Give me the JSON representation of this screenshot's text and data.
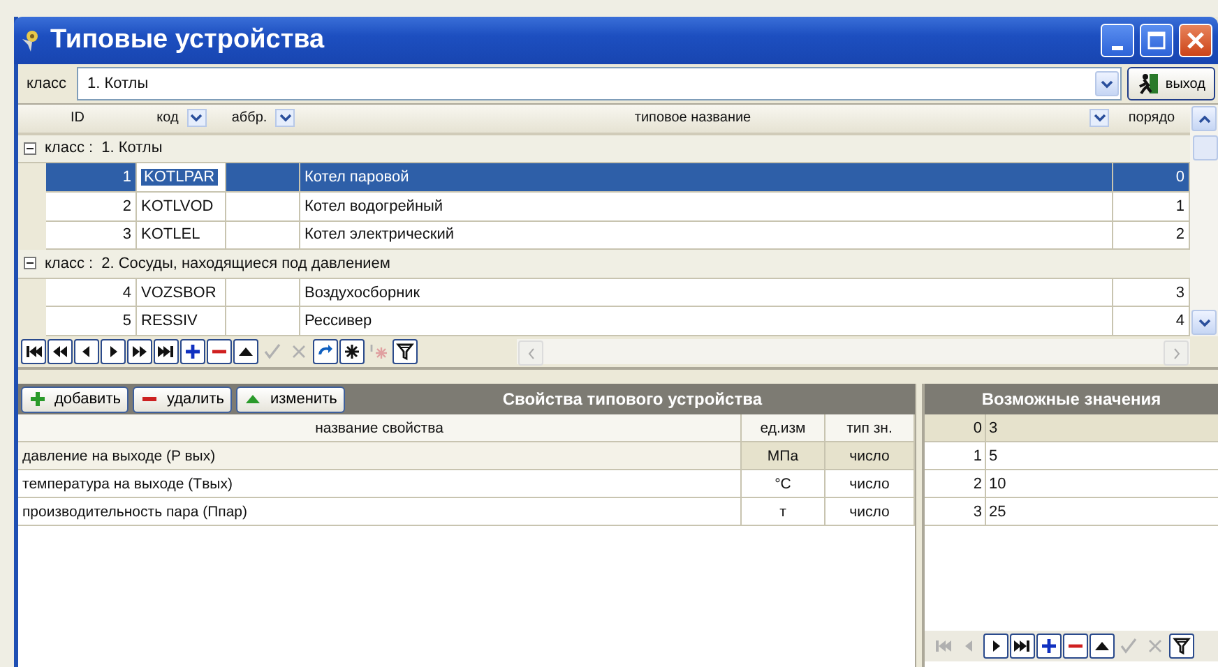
{
  "window": {
    "title": "Типовые устройства"
  },
  "class_filter": {
    "label": "класс",
    "value": "1. Котлы"
  },
  "exit_button": {
    "label": "выход"
  },
  "grid": {
    "columns": [
      {
        "label": "ID",
        "dropdown": false
      },
      {
        "label": "код",
        "dropdown": true
      },
      {
        "label": "аббр.",
        "dropdown": true
      },
      {
        "label": "типовое название",
        "dropdown": true
      },
      {
        "label": "порядо",
        "dropdown": false
      }
    ],
    "groups": [
      {
        "label": "класс :",
        "name": "1. Котлы",
        "expanded": true,
        "rows": [
          {
            "id": "1",
            "code": "KOTLPAR",
            "name": "Котел паровой",
            "order": "0",
            "selected": true
          },
          {
            "id": "2",
            "code": "KOTLVOD",
            "name": "Котел водогрейный",
            "order": "1",
            "selected": false
          },
          {
            "id": "3",
            "code": "KOTLEL",
            "name": "Котел электрический",
            "order": "2",
            "selected": false
          }
        ]
      },
      {
        "label": "класс :",
        "name": "2. Сосуды, находящиеся под давлением",
        "expanded": true,
        "rows": [
          {
            "id": "4",
            "code": "VOZSBOR",
            "name": "Воздухосборник",
            "order": "3",
            "selected": false
          },
          {
            "id": "5",
            "code": "RESSIV",
            "name": "Рессивер",
            "order": "4",
            "selected": false
          }
        ]
      }
    ]
  },
  "grid_nav": [
    {
      "kind": "first",
      "disabled": false
    },
    {
      "kind": "prior-page",
      "disabled": false
    },
    {
      "kind": "prior",
      "disabled": false
    },
    {
      "kind": "next",
      "disabled": false
    },
    {
      "kind": "next-page",
      "disabled": false
    },
    {
      "kind": "last",
      "disabled": false
    },
    {
      "kind": "insert",
      "disabled": false
    },
    {
      "kind": "delete",
      "disabled": false
    },
    {
      "kind": "edit",
      "disabled": false
    },
    {
      "kind": "post",
      "disabled": true
    },
    {
      "kind": "cancel",
      "disabled": true
    },
    {
      "kind": "refresh",
      "disabled": false
    },
    {
      "kind": "star",
      "disabled": false
    },
    {
      "kind": "star-insert",
      "disabled": true
    },
    {
      "kind": "filter",
      "disabled": false
    }
  ],
  "properties": {
    "buttons": [
      {
        "kind": "add",
        "label": "добавить"
      },
      {
        "kind": "remove",
        "label": "удалить"
      },
      {
        "kind": "edit",
        "label": "изменить"
      }
    ],
    "title": "Свойства типового устройства",
    "columns": [
      "название свойства",
      "ед.изм",
      "тип зн."
    ],
    "rows": [
      {
        "name": "давление на выходе (P вых)",
        "unit": "МПа",
        "type": "число",
        "selected": true
      },
      {
        "name": "температура на выходе (Tвых)",
        "unit": "°C",
        "type": "число",
        "selected": false
      },
      {
        "name": "производительность пара (Ппар)",
        "unit": "т",
        "type": "число",
        "selected": false
      }
    ]
  },
  "values": {
    "title": "Возможные значения",
    "rows": [
      {
        "index": "0",
        "value": "3",
        "selected": true
      },
      {
        "index": "1",
        "value": "5",
        "selected": false
      },
      {
        "index": "2",
        "value": "10",
        "selected": false
      },
      {
        "index": "3",
        "value": "25",
        "selected": false
      }
    ],
    "nav": [
      {
        "kind": "first",
        "disabled": true
      },
      {
        "kind": "prior",
        "disabled": true
      },
      {
        "kind": "next",
        "disabled": false
      },
      {
        "kind": "last",
        "disabled": false
      },
      {
        "kind": "insert",
        "disabled": false
      },
      {
        "kind": "delete",
        "disabled": false
      },
      {
        "kind": "edit",
        "disabled": false
      },
      {
        "kind": "post",
        "disabled": true
      },
      {
        "kind": "cancel",
        "disabled": true
      },
      {
        "kind": "filter",
        "disabled": false
      }
    ]
  }
}
